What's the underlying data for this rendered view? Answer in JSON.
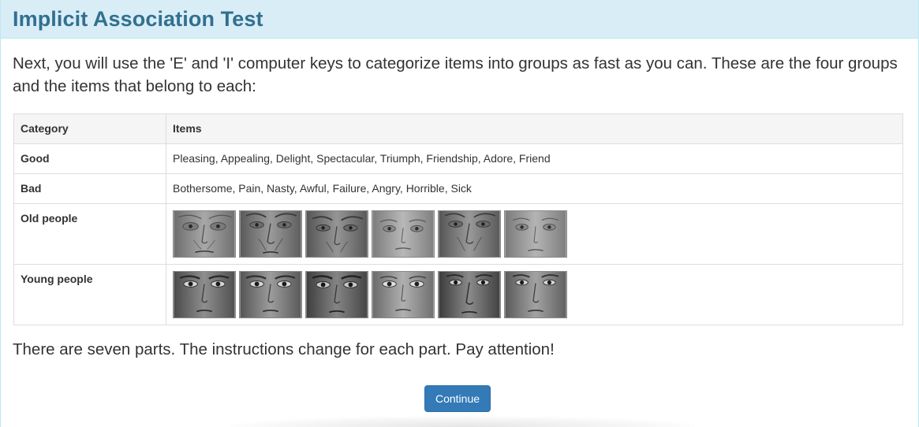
{
  "header": {
    "title": "Implicit Association Test"
  },
  "intro": {
    "text": "Next, you will use the 'E' and 'I' computer keys to categorize items into groups as fast as you can. These are the four groups and the items that belong to each:"
  },
  "table": {
    "headers": {
      "category": "Category",
      "items": "Items"
    },
    "rows": [
      {
        "category": "Good",
        "items": "Pleasing, Appealing, Delight, Spectacular, Triumph, Friendship, Adore, Friend"
      },
      {
        "category": "Bad",
        "items": "Bothersome, Pain, Nasty, Awful, Failure, Angry, Horrible, Sick"
      },
      {
        "category": "Old people",
        "images": [
          "old-face-1",
          "old-face-2",
          "old-face-3",
          "old-face-4",
          "old-face-5",
          "old-face-6"
        ]
      },
      {
        "category": "Young people",
        "images": [
          "young-face-1",
          "young-face-2",
          "young-face-3",
          "young-face-4",
          "young-face-5",
          "young-face-6"
        ]
      }
    ]
  },
  "outro": {
    "text": "There are seven parts. The instructions change for each part. Pay attention!"
  },
  "continue_button": {
    "label": "Continue"
  },
  "colors": {
    "header_bg": "#d9edf7",
    "header_text": "#31708f",
    "button_bg": "#337ab7"
  }
}
